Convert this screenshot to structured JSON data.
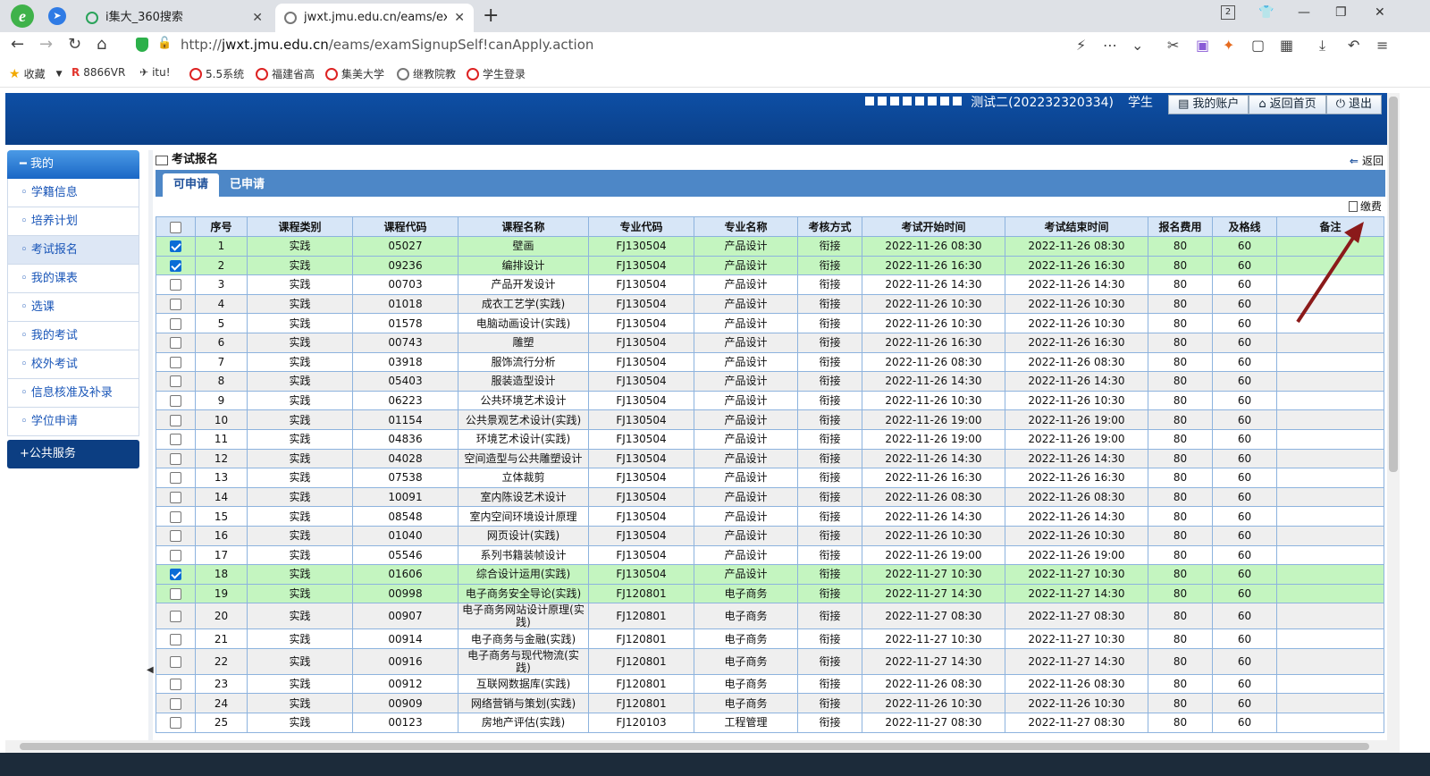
{
  "browser": {
    "tabs": [
      {
        "title": "i集大_360搜索"
      },
      {
        "title": "jwxt.jmu.edu.cn/eams/exam"
      }
    ],
    "tab_counter": "2",
    "url_domain": "jwxt.jmu.edu.cn",
    "url_prefix": "http://",
    "url_path": "/eams/examSignupSelf!canApply.action",
    "bookmarks": [
      "收藏",
      "8866VR",
      "itu!",
      "5.5系统",
      "福建省高",
      "集美大学",
      "继教院教",
      "学生登录"
    ]
  },
  "header": {
    "user": "测试二(202232320334)",
    "role": "学生",
    "buttons": [
      "我的账户",
      "返回首页",
      "退出"
    ]
  },
  "sidebar": {
    "group": "我的",
    "items": [
      "学籍信息",
      "培养计划",
      "考试报名",
      "我的课表",
      "选课",
      "我的考试",
      "校外考试",
      "信息核准及补录",
      "学位申请"
    ],
    "selected": "考试报名",
    "footer": "公共服务"
  },
  "content": {
    "title": "考试报名",
    "back": "返回",
    "tabs": [
      "可申请",
      "已申请"
    ],
    "pay": "缴费",
    "columns": [
      "序号",
      "课程类别",
      "课程代码",
      "课程名称",
      "专业代码",
      "专业名称",
      "考核方式",
      "考试开始时间",
      "考试结束时间",
      "报名费用",
      "及格线",
      "备注"
    ],
    "rows": [
      {
        "checked": true,
        "cells": [
          "1",
          "实践",
          "05027",
          "壁画",
          "FJ130504",
          "产品设计",
          "衔接",
          "2022-11-26 08:30",
          "2022-11-26 08:30",
          "80",
          "60",
          ""
        ]
      },
      {
        "checked": true,
        "cells": [
          "2",
          "实践",
          "09236",
          "编排设计",
          "FJ130504",
          "产品设计",
          "衔接",
          "2022-11-26 16:30",
          "2022-11-26 16:30",
          "80",
          "60",
          ""
        ]
      },
      {
        "checked": false,
        "cells": [
          "3",
          "实践",
          "00703",
          "产品开发设计",
          "FJ130504",
          "产品设计",
          "衔接",
          "2022-11-26 14:30",
          "2022-11-26 14:30",
          "80",
          "60",
          ""
        ]
      },
      {
        "checked": false,
        "cells": [
          "4",
          "实践",
          "01018",
          "成衣工艺学(实践)",
          "FJ130504",
          "产品设计",
          "衔接",
          "2022-11-26 10:30",
          "2022-11-26 10:30",
          "80",
          "60",
          ""
        ]
      },
      {
        "checked": false,
        "cells": [
          "5",
          "实践",
          "01578",
          "电脑动画设计(实践)",
          "FJ130504",
          "产品设计",
          "衔接",
          "2022-11-26 10:30",
          "2022-11-26 10:30",
          "80",
          "60",
          ""
        ]
      },
      {
        "checked": false,
        "cells": [
          "6",
          "实践",
          "00743",
          "雕塑",
          "FJ130504",
          "产品设计",
          "衔接",
          "2022-11-26 16:30",
          "2022-11-26 16:30",
          "80",
          "60",
          ""
        ]
      },
      {
        "checked": false,
        "cells": [
          "7",
          "实践",
          "03918",
          "服饰流行分析",
          "FJ130504",
          "产品设计",
          "衔接",
          "2022-11-26 08:30",
          "2022-11-26 08:30",
          "80",
          "60",
          ""
        ]
      },
      {
        "checked": false,
        "cells": [
          "8",
          "实践",
          "05403",
          "服装造型设计",
          "FJ130504",
          "产品设计",
          "衔接",
          "2022-11-26 14:30",
          "2022-11-26 14:30",
          "80",
          "60",
          ""
        ]
      },
      {
        "checked": false,
        "cells": [
          "9",
          "实践",
          "06223",
          "公共环境艺术设计",
          "FJ130504",
          "产品设计",
          "衔接",
          "2022-11-26 10:30",
          "2022-11-26 10:30",
          "80",
          "60",
          ""
        ]
      },
      {
        "checked": false,
        "cells": [
          "10",
          "实践",
          "01154",
          "公共景观艺术设计(实践)",
          "FJ130504",
          "产品设计",
          "衔接",
          "2022-11-26 19:00",
          "2022-11-26 19:00",
          "80",
          "60",
          ""
        ]
      },
      {
        "checked": false,
        "cells": [
          "11",
          "实践",
          "04836",
          "环境艺术设计(实践)",
          "FJ130504",
          "产品设计",
          "衔接",
          "2022-11-26 19:00",
          "2022-11-26 19:00",
          "80",
          "60",
          ""
        ]
      },
      {
        "checked": false,
        "cells": [
          "12",
          "实践",
          "04028",
          "空间造型与公共雕塑设计",
          "FJ130504",
          "产品设计",
          "衔接",
          "2022-11-26 14:30",
          "2022-11-26 14:30",
          "80",
          "60",
          ""
        ]
      },
      {
        "checked": false,
        "cells": [
          "13",
          "实践",
          "07538",
          "立体裁剪",
          "FJ130504",
          "产品设计",
          "衔接",
          "2022-11-26 16:30",
          "2022-11-26 16:30",
          "80",
          "60",
          ""
        ]
      },
      {
        "checked": false,
        "cells": [
          "14",
          "实践",
          "10091",
          "室内陈设艺术设计",
          "FJ130504",
          "产品设计",
          "衔接",
          "2022-11-26 08:30",
          "2022-11-26 08:30",
          "80",
          "60",
          ""
        ]
      },
      {
        "checked": false,
        "cells": [
          "15",
          "实践",
          "08548",
          "室内空间环境设计原理",
          "FJ130504",
          "产品设计",
          "衔接",
          "2022-11-26 14:30",
          "2022-11-26 14:30",
          "80",
          "60",
          ""
        ]
      },
      {
        "checked": false,
        "cells": [
          "16",
          "实践",
          "01040",
          "网页设计(实践)",
          "FJ130504",
          "产品设计",
          "衔接",
          "2022-11-26 10:30",
          "2022-11-26 10:30",
          "80",
          "60",
          ""
        ]
      },
      {
        "checked": false,
        "cells": [
          "17",
          "实践",
          "05546",
          "系列书籍装帧设计",
          "FJ130504",
          "产品设计",
          "衔接",
          "2022-11-26 19:00",
          "2022-11-26 19:00",
          "80",
          "60",
          ""
        ]
      },
      {
        "checked": true,
        "cells": [
          "18",
          "实践",
          "01606",
          "综合设计运用(实践)",
          "FJ130504",
          "产品设计",
          "衔接",
          "2022-11-27 10:30",
          "2022-11-27 10:30",
          "80",
          "60",
          ""
        ]
      },
      {
        "checked": false,
        "green": true,
        "cells": [
          "19",
          "实践",
          "00998",
          "电子商务安全导论(实践)",
          "FJ120801",
          "电子商务",
          "衔接",
          "2022-11-27 14:30",
          "2022-11-27 14:30",
          "80",
          "60",
          ""
        ]
      },
      {
        "checked": false,
        "tall": true,
        "cells": [
          "20",
          "实践",
          "00907",
          "电子商务网站设计原理(实践)",
          "FJ120801",
          "电子商务",
          "衔接",
          "2022-11-27 08:30",
          "2022-11-27 08:30",
          "80",
          "60",
          ""
        ]
      },
      {
        "checked": false,
        "cells": [
          "21",
          "实践",
          "00914",
          "电子商务与金融(实践)",
          "FJ120801",
          "电子商务",
          "衔接",
          "2022-11-27 10:30",
          "2022-11-27 10:30",
          "80",
          "60",
          ""
        ]
      },
      {
        "checked": false,
        "tall": true,
        "cells": [
          "22",
          "实践",
          "00916",
          "电子商务与现代物流(实践)",
          "FJ120801",
          "电子商务",
          "衔接",
          "2022-11-27 14:30",
          "2022-11-27 14:30",
          "80",
          "60",
          ""
        ]
      },
      {
        "checked": false,
        "cells": [
          "23",
          "实践",
          "00912",
          "互联网数据库(实践)",
          "FJ120801",
          "电子商务",
          "衔接",
          "2022-11-26 08:30",
          "2022-11-26 08:30",
          "80",
          "60",
          ""
        ]
      },
      {
        "checked": false,
        "cells": [
          "24",
          "实践",
          "00909",
          "网络营销与策划(实践)",
          "FJ120801",
          "电子商务",
          "衔接",
          "2022-11-26 10:30",
          "2022-11-26 10:30",
          "80",
          "60",
          ""
        ]
      },
      {
        "checked": false,
        "cells": [
          "25",
          "实践",
          "00123",
          "房地产评估(实践)",
          "FJ120103",
          "工程管理",
          "衔接",
          "2022-11-27 08:30",
          "2022-11-27 08:30",
          "80",
          "60",
          ""
        ]
      }
    ]
  },
  "colors": {
    "banner": "#0e4fa5",
    "checked_row": "#c4f5c0",
    "arrow": "#8b1a1a"
  }
}
